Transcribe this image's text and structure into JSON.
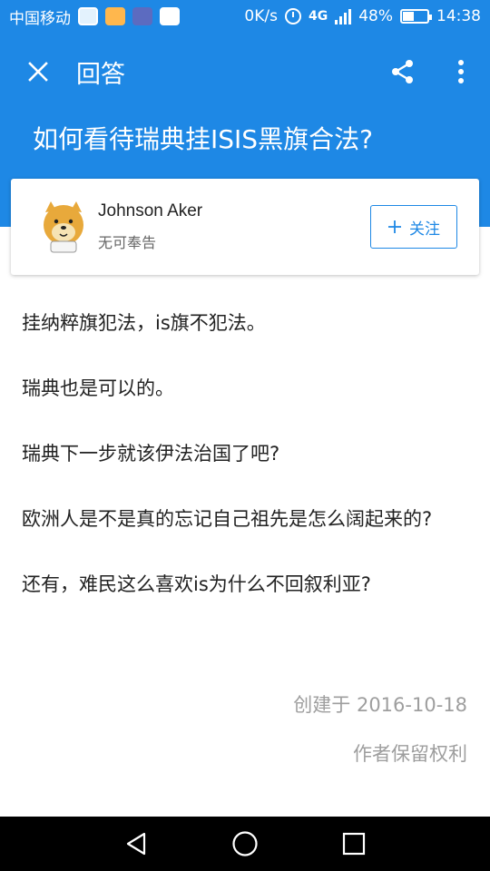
{
  "status_bar": {
    "carrier": "中国移动",
    "speed": "0K/s",
    "network": "4G",
    "battery": "48%",
    "battery_level": 0.48,
    "time": "14:38"
  },
  "app_bar": {
    "title": "回答",
    "close_icon": "close-icon",
    "share_icon": "share-icon",
    "more_icon": "more-vertical-icon"
  },
  "question": {
    "title": "如何看待瑞典挂ISIS黑旗合法?"
  },
  "author": {
    "name": "Johnson Aker",
    "bio": "无可奉告",
    "follow_label": "关注"
  },
  "answer": {
    "paragraphs": [
      "挂纳粹旗犯法，is旗不犯法。",
      "瑞典也是可以的。",
      "瑞典下一步就该伊法治国了吧?",
      "欧洲人是不是真的忘记自己祖先是怎么阔起来的?",
      "还有，难民这么喜欢is为什么不回叙利亚?"
    ]
  },
  "meta": {
    "created": "创建于 2016-10-18",
    "rights": "作者保留权利"
  },
  "colors": {
    "primary": "#1e88e5",
    "text": "#222222",
    "muted": "#9e9e9e"
  }
}
